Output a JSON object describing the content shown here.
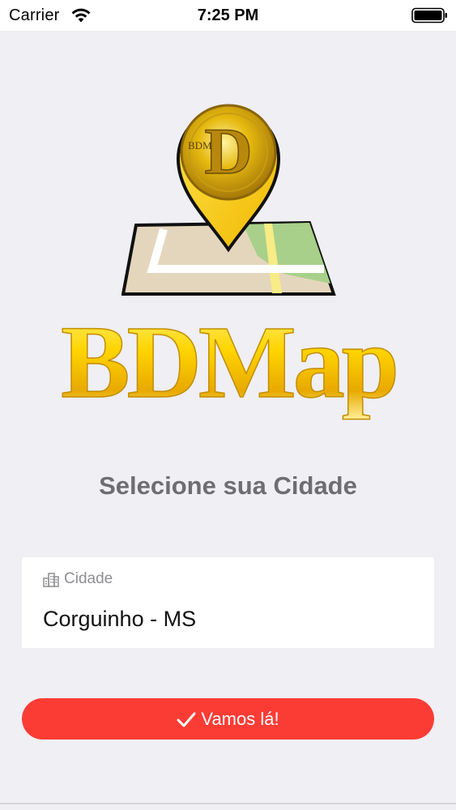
{
  "status_bar": {
    "carrier": "Carrier",
    "time": "7:25 PM",
    "wifi_icon": "wifi-icon",
    "battery_icon": "battery-icon"
  },
  "logo": {
    "emblem_text": "BDM",
    "wordmark": "BDMap",
    "icon": "map-pin-icon"
  },
  "headline": "Selecione sua Cidade",
  "city_field": {
    "label": "Cidade",
    "icon": "city-icon",
    "value": "Corguinho - MS"
  },
  "submit_button": {
    "label": "Vamos lá!",
    "icon": "check-icon"
  },
  "colors": {
    "background": "#efeff4",
    "accent": "#fb3c35",
    "headline": "#6d6d72",
    "gold": "#e8b800"
  }
}
